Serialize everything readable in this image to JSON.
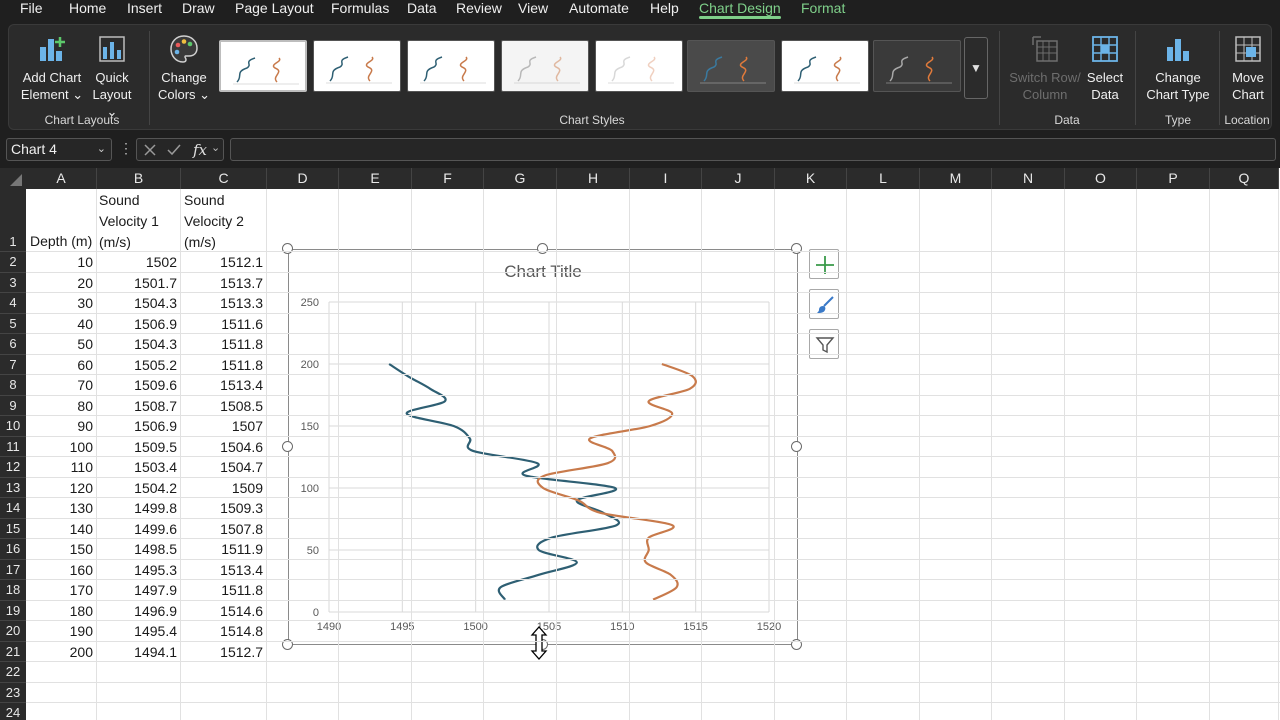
{
  "menu": {
    "tabs": [
      "File",
      "Home",
      "Insert",
      "Draw",
      "Page Layout",
      "Formulas",
      "Data",
      "Review",
      "View",
      "Automate",
      "Help",
      "Chart Design",
      "Format"
    ]
  },
  "ribbon": {
    "chart_layouts": {
      "add_chart_element": [
        "Add Chart",
        "Element ⌄"
      ],
      "quick_layout": [
        "Quick",
        "Layout ⌄"
      ],
      "label": "Chart Layouts"
    },
    "change_colors": [
      "Change",
      "Colors ⌄"
    ],
    "chart_styles_label": "Chart Styles",
    "data": {
      "switch_row_column": [
        "Switch Row/",
        "Column"
      ],
      "select_data": [
        "Select",
        "Data"
      ],
      "label": "Data"
    },
    "type": {
      "change_chart_type": [
        "Change",
        "Chart Type"
      ],
      "label": "Type"
    },
    "location": {
      "move_chart": [
        "Move",
        "Chart"
      ],
      "label": "Location"
    },
    "gallery_more_icon": "chevron-down-icon"
  },
  "formula_bar": {
    "name_box": "Chart 4",
    "name_box_icon": "chevron-down-icon",
    "cancel_icon": "close-icon",
    "enter_icon": "check-icon",
    "fx_label": "fx",
    "formula": ""
  },
  "sheet": {
    "columns": [
      "A",
      "B",
      "C",
      "D",
      "E",
      "F",
      "G",
      "H",
      "I",
      "J",
      "K",
      "L",
      "M",
      "N",
      "O",
      "P",
      "Q"
    ],
    "rows": [
      "1",
      "2",
      "3",
      "4",
      "5",
      "6",
      "7",
      "8",
      "9",
      "10",
      "11",
      "12",
      "13",
      "14",
      "15",
      "16",
      "17",
      "18",
      "19",
      "20",
      "21",
      "22",
      "23",
      "24"
    ],
    "headers": {
      "a": "Depth (m)",
      "b": [
        "Sound",
        "Velocity 1",
        "(m/s)"
      ],
      "c": [
        "Sound",
        "Velocity 2",
        "(m/s)"
      ]
    },
    "data_rows": [
      [
        "10",
        "1502",
        "1512.1"
      ],
      [
        "20",
        "1501.7",
        "1513.7"
      ],
      [
        "30",
        "1504.3",
        "1513.3"
      ],
      [
        "40",
        "1506.9",
        "1511.6"
      ],
      [
        "50",
        "1504.3",
        "1511.8"
      ],
      [
        "60",
        "1505.2",
        "1511.8"
      ],
      [
        "70",
        "1509.6",
        "1513.4"
      ],
      [
        "80",
        "1508.7",
        "1508.5"
      ],
      [
        "90",
        "1506.9",
        "1507"
      ],
      [
        "100",
        "1509.5",
        "1504.6"
      ],
      [
        "110",
        "1503.4",
        "1504.7"
      ],
      [
        "120",
        "1504.2",
        "1509"
      ],
      [
        "130",
        "1499.8",
        "1509.3"
      ],
      [
        "140",
        "1499.6",
        "1507.8"
      ],
      [
        "150",
        "1498.5",
        "1511.9"
      ],
      [
        "160",
        "1495.3",
        "1513.4"
      ],
      [
        "170",
        "1497.9",
        "1511.8"
      ],
      [
        "180",
        "1496.9",
        "1514.6"
      ],
      [
        "190",
        "1495.4",
        "1514.8"
      ],
      [
        "200",
        "1494.1",
        "1512.7"
      ]
    ]
  },
  "chart_data": {
    "type": "scatter",
    "title": "Chart Title",
    "xlim": [
      1490,
      1520
    ],
    "ylim": [
      0,
      250
    ],
    "x_ticks": [
      "1490",
      "1495",
      "1500",
      "1505",
      "1510",
      "1515",
      "1520"
    ],
    "y_ticks": [
      "0",
      "50",
      "100",
      "150",
      "200",
      "250"
    ],
    "grid": true,
    "smooth_lines": true,
    "series": [
      {
        "color": "#2e5f73",
        "x": [
          1502,
          1501.7,
          1504.3,
          1506.9,
          1504.3,
          1505.2,
          1509.6,
          1508.7,
          1506.9,
          1509.5,
          1503.4,
          1504.2,
          1499.8,
          1499.6,
          1498.5,
          1495.3,
          1497.9,
          1496.9,
          1495.4,
          1494.1
        ],
        "y": [
          10,
          20,
          30,
          40,
          50,
          60,
          70,
          80,
          90,
          100,
          110,
          120,
          130,
          140,
          150,
          160,
          170,
          180,
          190,
          200
        ]
      },
      {
        "color": "#c87a4b",
        "x": [
          1512.1,
          1513.7,
          1513.3,
          1511.6,
          1511.8,
          1511.8,
          1513.4,
          1508.5,
          1507,
          1504.6,
          1504.7,
          1509,
          1509.3,
          1507.8,
          1511.9,
          1513.4,
          1511.8,
          1514.6,
          1514.8,
          1512.7
        ],
        "y": [
          10,
          20,
          30,
          40,
          50,
          60,
          70,
          80,
          90,
          100,
          110,
          120,
          130,
          140,
          150,
          160,
          170,
          180,
          190,
          200
        ]
      }
    ]
  },
  "chart_side_buttons": {
    "elements_icon": "plus-icon",
    "styles_icon": "paintbrush-icon",
    "filters_icon": "filter-icon"
  },
  "colors": {
    "accent": "#7fd08a",
    "series1": "#2e5f73",
    "series2": "#c87a4b"
  }
}
